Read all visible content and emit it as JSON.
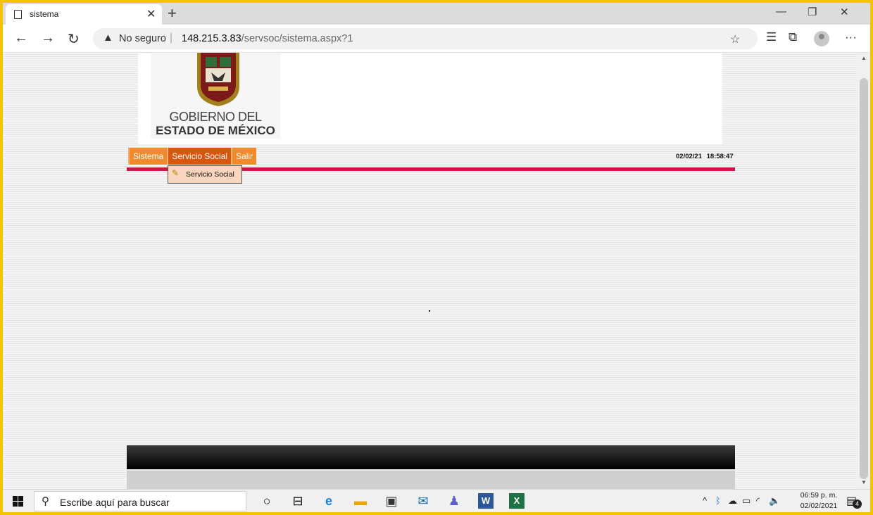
{
  "browser": {
    "tab_title": "sistema",
    "tab_close": "✕",
    "new_tab": "+",
    "win_minimize": "—",
    "win_restore": "❐",
    "win_close": "✕",
    "back": "←",
    "forward": "→",
    "refresh": "↻",
    "security_label": "No seguro",
    "url_host": "148.215.3.83",
    "url_path": "/servsoc/sistema.aspx?1",
    "more": "···"
  },
  "page": {
    "logo_line1": "GOBIERNO DEL",
    "logo_line2": "ESTADO DE MÉXICO",
    "menu": [
      {
        "label": "Sistema"
      },
      {
        "label": "Servicio Social"
      },
      {
        "label": "Salir"
      }
    ],
    "date": "02/02/21",
    "time": "18:58:47",
    "dropdown": {
      "label": "Servicio Social"
    },
    "colors": {
      "menu": "#f08a2c",
      "menu_active": "#d8560e",
      "rule": "#c8174a"
    }
  },
  "taskbar": {
    "search_placeholder": "Escribe aquí para buscar",
    "clock_time": "06:59 p. m.",
    "clock_date": "02/02/2021",
    "notification_count": "4",
    "apps": [
      "cortana-icon",
      "task-view-icon",
      "edge-icon",
      "file-explorer-icon",
      "store-icon",
      "mail-icon",
      "teams-icon",
      "word-icon",
      "excel-icon"
    ]
  }
}
